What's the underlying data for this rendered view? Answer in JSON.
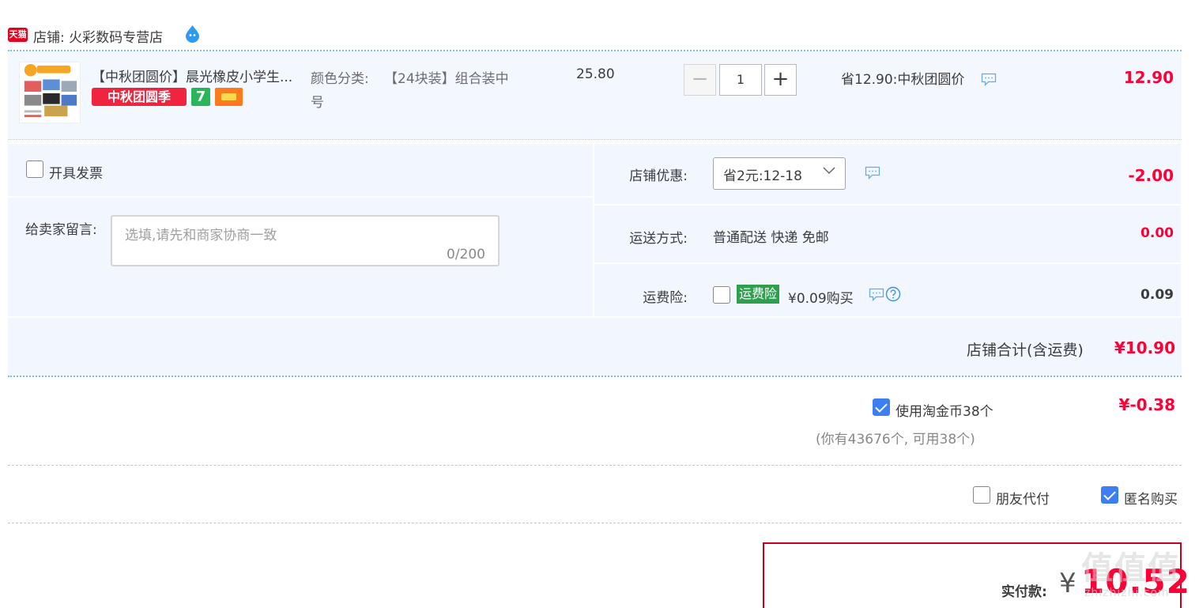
{
  "shop": {
    "badge": "天猫",
    "name": "店铺: 火彩数码专营店"
  },
  "item": {
    "title": "【中秋团圆价】晨光橡皮小学生...",
    "tag_promo": "中秋团圆季",
    "tag_seven": "7",
    "sku_label": "颜色分类:",
    "sku_value": "【24块装】组合装中",
    "sku_value_line2": "号",
    "unit_price": "25.80",
    "qty_minus": "−",
    "qty": "1",
    "qty_plus": "+",
    "promo": "省12.90:中秋团圆价",
    "total": "12.90"
  },
  "options": {
    "invoice_label": "开具发票",
    "message_label": "给卖家留言:",
    "message_placeholder": "选填,请先和商家协商一致",
    "message_count": "0/200",
    "coupon_label": "店铺优惠:",
    "coupon_value": "省2元:12-18",
    "coupon_discount": "-2.00",
    "shipping_label": "运送方式:",
    "shipping_value": "普通配送 快递 免邮",
    "shipping_fee": "0.00",
    "insurance_label": "运费险:",
    "insurance_tag": "运费险",
    "insurance_price": "¥0.09购买",
    "insurance_fee": "0.09"
  },
  "subtotal": {
    "label": "店铺合计(含运费)",
    "value": "¥10.90"
  },
  "coins": {
    "label": "使用淘金币38个",
    "value": "¥-0.38",
    "note": "(你有43676个, 可用38个)"
  },
  "extras": {
    "friend_pay": "朋友代付",
    "anonymous": "匿名购买"
  },
  "pay": {
    "label": "实付款:",
    "yen": "¥",
    "amount": "10.52"
  },
  "watermark": {
    "text": "值值值",
    "sub": "zhizhizhi.com"
  },
  "colors": {
    "price_red": "#ff0036",
    "tmall_red": "#e6001f",
    "checkbox_blue": "#3d7ef2",
    "panel_bg": "#f2f7ff",
    "insurance_green": "#2e9e4f"
  }
}
